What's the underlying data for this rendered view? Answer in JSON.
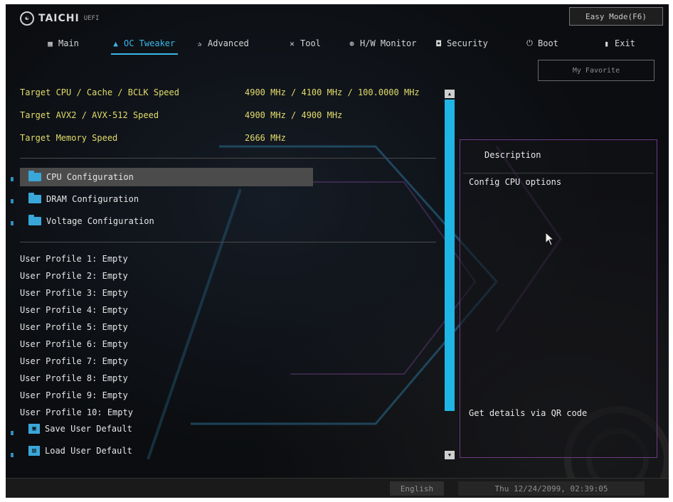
{
  "brand": {
    "name": "TAICHI",
    "sub": "UEFI",
    "logo_icon": "taichi-logo-icon"
  },
  "easy_mode_button": "Easy Mode(F6)",
  "nav": [
    {
      "label": "Main",
      "icon": "grid-icon",
      "active": false
    },
    {
      "label": "OC Tweaker",
      "icon": "flame-icon",
      "active": true
    },
    {
      "label": "Advanced",
      "icon": "star-icon",
      "active": false
    },
    {
      "label": "Tool",
      "icon": "tool-icon",
      "active": false
    },
    {
      "label": "H/W Monitor",
      "icon": "monitor-icon",
      "active": false
    },
    {
      "label": "Security",
      "icon": "shield-icon",
      "active": false
    },
    {
      "label": "Boot",
      "icon": "power-icon",
      "active": false
    },
    {
      "label": "Exit",
      "icon": "exit-icon",
      "active": false
    }
  ],
  "my_favorite": "My Favorite",
  "targets": [
    {
      "label": "Target CPU / Cache / BCLK Speed",
      "value": "4900 MHz / 4100 MHz / 100.0000 MHz"
    },
    {
      "label": "Target AVX2 / AVX-512 Speed",
      "value": "4900 MHz / 4900 MHz"
    },
    {
      "label": "Target Memory Speed",
      "value": "2666 MHz"
    }
  ],
  "configs": [
    {
      "label": "CPU Configuration",
      "selected": true
    },
    {
      "label": "DRAM Configuration",
      "selected": false
    },
    {
      "label": "Voltage Configuration",
      "selected": false
    }
  ],
  "profiles": [
    "User Profile 1: Empty",
    "User Profile 2: Empty",
    "User Profile 3: Empty",
    "User Profile 4: Empty",
    "User Profile 5: Empty",
    "User Profile 6: Empty",
    "User Profile 7: Empty",
    "User Profile 8: Empty",
    "User Profile 9: Empty",
    "User Profile 10: Empty"
  ],
  "actions": [
    {
      "label": "Save User Default",
      "icon": "save-icon"
    },
    {
      "label": "Load User Default",
      "icon": "load-icon"
    }
  ],
  "description": {
    "title": "Description",
    "text": "Config CPU options",
    "qr_text": "Get details via QR code"
  },
  "footer": {
    "language": "English",
    "datetime": "Thu 12/24/2099, 02:39:05"
  },
  "colors": {
    "accent": "#1fb6e6",
    "target_text": "#e2dc6a",
    "panel_border": "#6f3a84"
  }
}
